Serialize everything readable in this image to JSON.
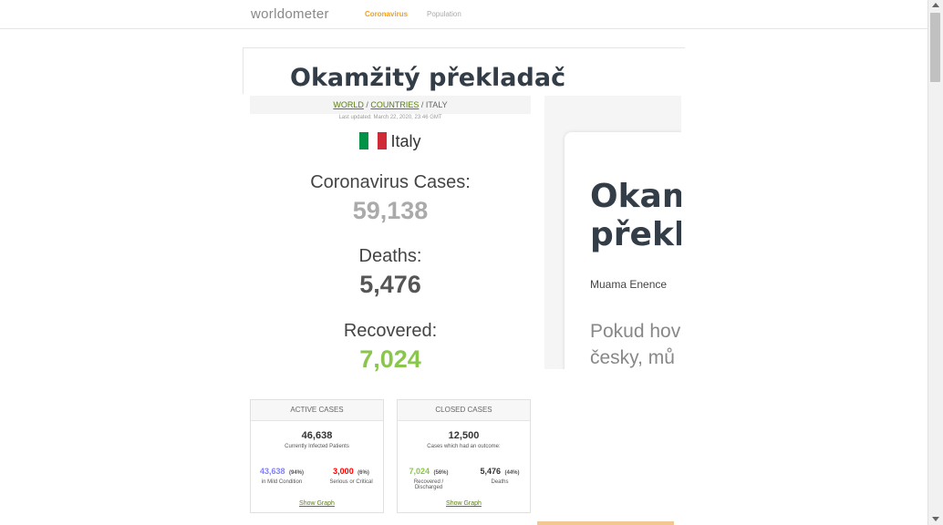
{
  "nav": {
    "logo": "worldometer",
    "links": [
      "Coronavirus",
      "Population"
    ]
  },
  "ad_top": {
    "title": "Okamžitý překladač"
  },
  "breadcrumb": {
    "world": "WORLD",
    "sep1": " / ",
    "countries": "COUNTRIES",
    "sep2": " / ",
    "current": "ITALY"
  },
  "last_updated": "Last updated: March 22, 2020, 23:46 GMT",
  "country": {
    "name": "Italy",
    "flag_colors": [
      "#009246",
      "#ffffff",
      "#ce2b37"
    ]
  },
  "stats": {
    "cases_label": "Coronavirus Cases:",
    "cases_value": "59,138",
    "deaths_label": "Deaths:",
    "deaths_value": "5,476",
    "recovered_label": "Recovered:",
    "recovered_value": "7,024"
  },
  "colors": {
    "cases": "#aaaaaa",
    "deaths": "#555555",
    "recovered": "#8ac64c",
    "mild": "#8080ff",
    "serious": "#ff0000",
    "link": "#5a7d0f"
  },
  "active_cases": {
    "header": "ACTIVE CASES",
    "total": "46,638",
    "subtitle": "Currently Infected Patients",
    "mild_value": "43,638",
    "mild_pct": "(94%)",
    "mild_label": "in Mild Condition",
    "serious_value": "3,000",
    "serious_pct": "(6%)",
    "serious_label": "Serious or Critical",
    "link": "Show Graph"
  },
  "closed_cases": {
    "header": "CLOSED CASES",
    "total": "12,500",
    "subtitle": "Cases which had an outcome:",
    "recovered_value": "7,024",
    "recovered_pct": "(56%)",
    "recovered_label": "Recovered / Discharged",
    "deaths_value": "5,476",
    "deaths_pct": "(44%)",
    "deaths_label": "Deaths",
    "link": "Show Graph"
  },
  "ad_right": {
    "title_line1": "Okam",
    "title_line2": "překla",
    "author": "Muama Enence",
    "text_line1": "Pokud hov",
    "text_line2": "česky, mů"
  }
}
